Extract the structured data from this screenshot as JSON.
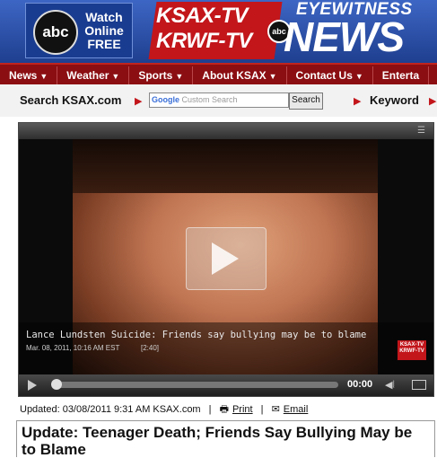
{
  "header": {
    "promo_text": "Watch Online FREE",
    "station_line1": "KSAX-TV",
    "station_line2": "KRWF-TV",
    "abc": "abc",
    "eyewitness": "EYEWITNESS",
    "news": "NEWS"
  },
  "nav": {
    "items": [
      {
        "label": "News"
      },
      {
        "label": "Weather"
      },
      {
        "label": "Sports"
      },
      {
        "label": "About KSAX"
      },
      {
        "label": "Contact Us"
      },
      {
        "label": "Enterta"
      }
    ]
  },
  "search": {
    "label": "Search KSAX.com",
    "placeholder": "Custom Search",
    "google": "Google",
    "button": "Search",
    "keyword_label": "Keyword"
  },
  "video": {
    "title": "Lance Lundsten Suicide: Friends say bullying may be to blame",
    "date": "Mar. 08, 2011, 10:16 AM EST",
    "duration": "[2:40]",
    "time": "00:00",
    "mini_logo_1": "KSAX-TV",
    "mini_logo_2": "KRWF-TV",
    "progress": 0
  },
  "article": {
    "updated": "Updated: 03/08/2011 9:31 AM KSAX.com",
    "print": "Print",
    "email": "Email",
    "headline": "Update: Teenager Death; Friends Say Bullying May be to Blame"
  },
  "colors": {
    "header_blue": "#2d4fa3",
    "brand_red": "#c2161b",
    "nav_red": "#8b0e12"
  }
}
